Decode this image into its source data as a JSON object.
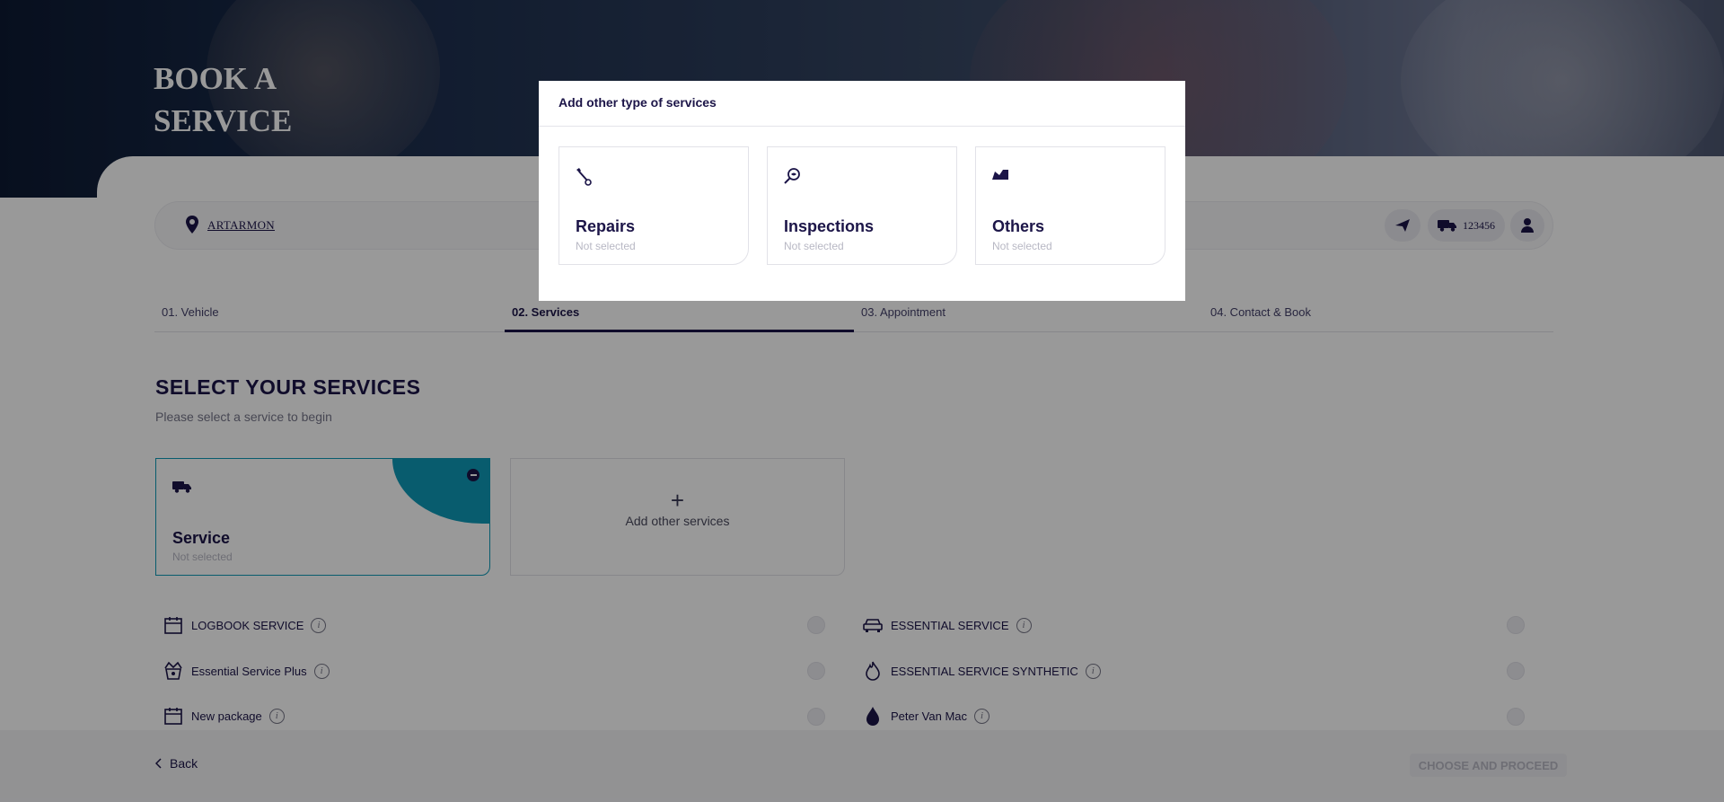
{
  "hero": {
    "title": "BOOK A SERVICE"
  },
  "location": {
    "name": "ARTARMON"
  },
  "vehicle": {
    "plate": "123456"
  },
  "steps": [
    {
      "label": "01. Vehicle"
    },
    {
      "label": "02. Services"
    },
    {
      "label": "03. Appointment"
    },
    {
      "label": "04. Contact & Book"
    }
  ],
  "services": {
    "title": "SELECT YOUR SERVICES",
    "subtitle": "Please select a service to begin",
    "selected_card": {
      "title": "Service",
      "status": "Not selected"
    },
    "add_card": {
      "plus": "+",
      "label": "Add other services"
    },
    "packages": [
      {
        "name": "LOGBOOK SERVICE",
        "icon": "calendar-icon"
      },
      {
        "name": "ESSENTIAL SERVICE",
        "icon": "car-icon"
      },
      {
        "name": "Essential Service Plus",
        "icon": "basket-icon"
      },
      {
        "name": "ESSENTIAL SERVICE SYNTHETIC",
        "icon": "flame-icon"
      },
      {
        "name": "New package",
        "icon": "calendar-icon"
      },
      {
        "name": "Peter Van Mac",
        "icon": "drop-icon"
      }
    ],
    "info_glyph": "i"
  },
  "footer": {
    "back_label": "Back",
    "proceed_label": "CHOOSE AND PROCEED"
  },
  "modal": {
    "title": "Add other type of services",
    "cards": [
      {
        "title": "Repairs",
        "status": "Not selected",
        "icon": "wrench-icon"
      },
      {
        "title": "Inspections",
        "status": "Not selected",
        "icon": "magnifier-icon"
      },
      {
        "title": "Others",
        "status": "Not selected",
        "icon": "gauge-icon"
      }
    ]
  },
  "colors": {
    "primary": "#1c1548",
    "accent": "#0e9ab7",
    "overlay": "rgba(0,0,0,0.4)"
  }
}
